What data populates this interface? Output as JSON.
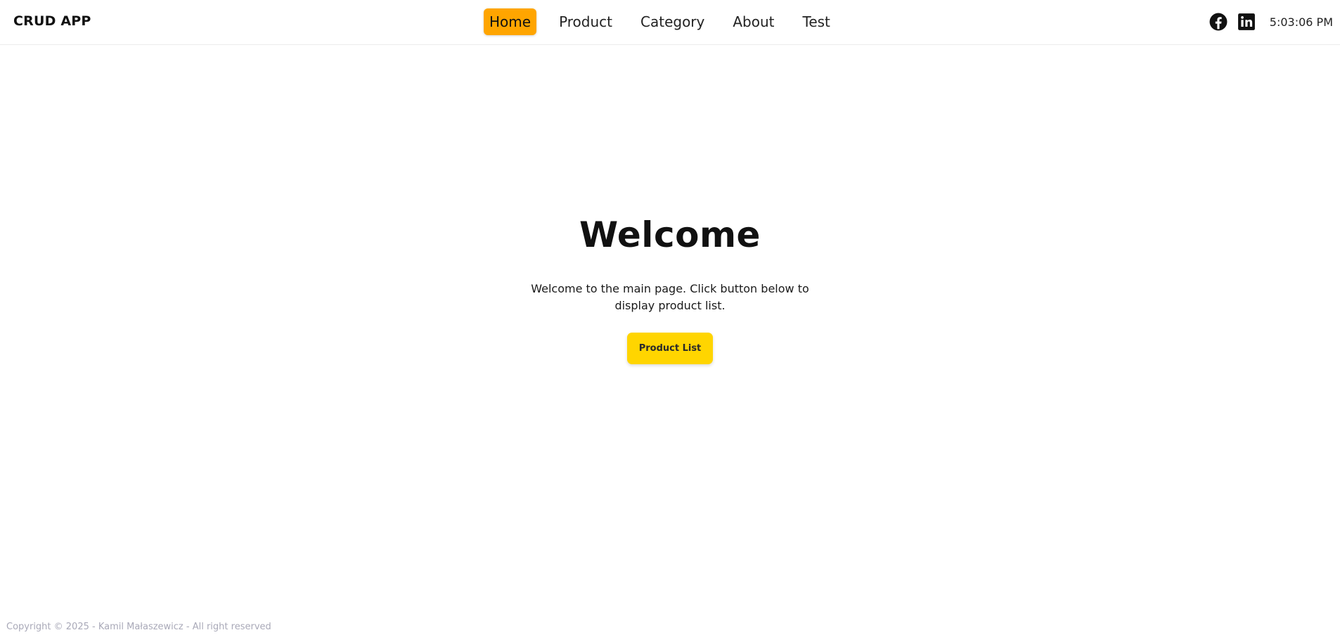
{
  "header": {
    "brand": "CRUD APP",
    "nav": [
      {
        "label": "Home",
        "active": true
      },
      {
        "label": "Product",
        "active": false
      },
      {
        "label": "Category",
        "active": false
      },
      {
        "label": "About",
        "active": false
      },
      {
        "label": "Test",
        "active": false
      }
    ],
    "social_icons": [
      "facebook-icon",
      "linkedin-icon"
    ],
    "clock": "5:03:06 PM"
  },
  "main": {
    "title": "Welcome",
    "text": "Welcome to the main page. Click button below to display product list.",
    "button_label": "Product List"
  },
  "footer": {
    "copyright": "Copyright © 2025 - Kamil Małaszewicz - All right reserved"
  },
  "colors": {
    "active_nav": "#ffa500",
    "cta_button": "#ffd500",
    "footer_text": "#a9a9b8"
  }
}
